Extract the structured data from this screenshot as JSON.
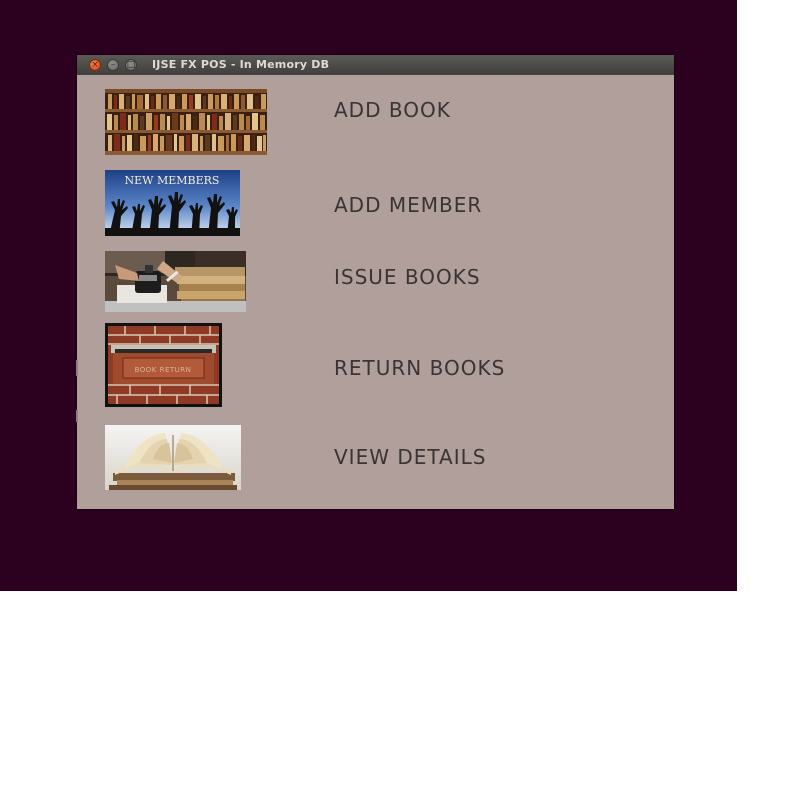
{
  "window": {
    "title": "IJSE FX POS - In Memory DB",
    "controls": {
      "close_glyph": "×",
      "minimize_glyph": "–",
      "maximize_glyph": "□"
    }
  },
  "menu": {
    "items": [
      {
        "label": "ADD BOOK",
        "image": "bookshelf-image"
      },
      {
        "label": "ADD MEMBER",
        "image": "new-members-image",
        "image_text": "NEW MEMBERS"
      },
      {
        "label": "ISSUE BOOKS",
        "image": "stamp-books-image"
      },
      {
        "label": "RETURN BOOKS",
        "image": "book-return-slot-image",
        "image_text": "BOOK RETURN"
      },
      {
        "label": "VIEW DETAILS",
        "image": "open-book-image"
      }
    ]
  },
  "colors": {
    "desktop": "#2c0120",
    "window_bg": "#b09f9b",
    "label_text": "#3a3434",
    "close_button": "#e05a26"
  }
}
